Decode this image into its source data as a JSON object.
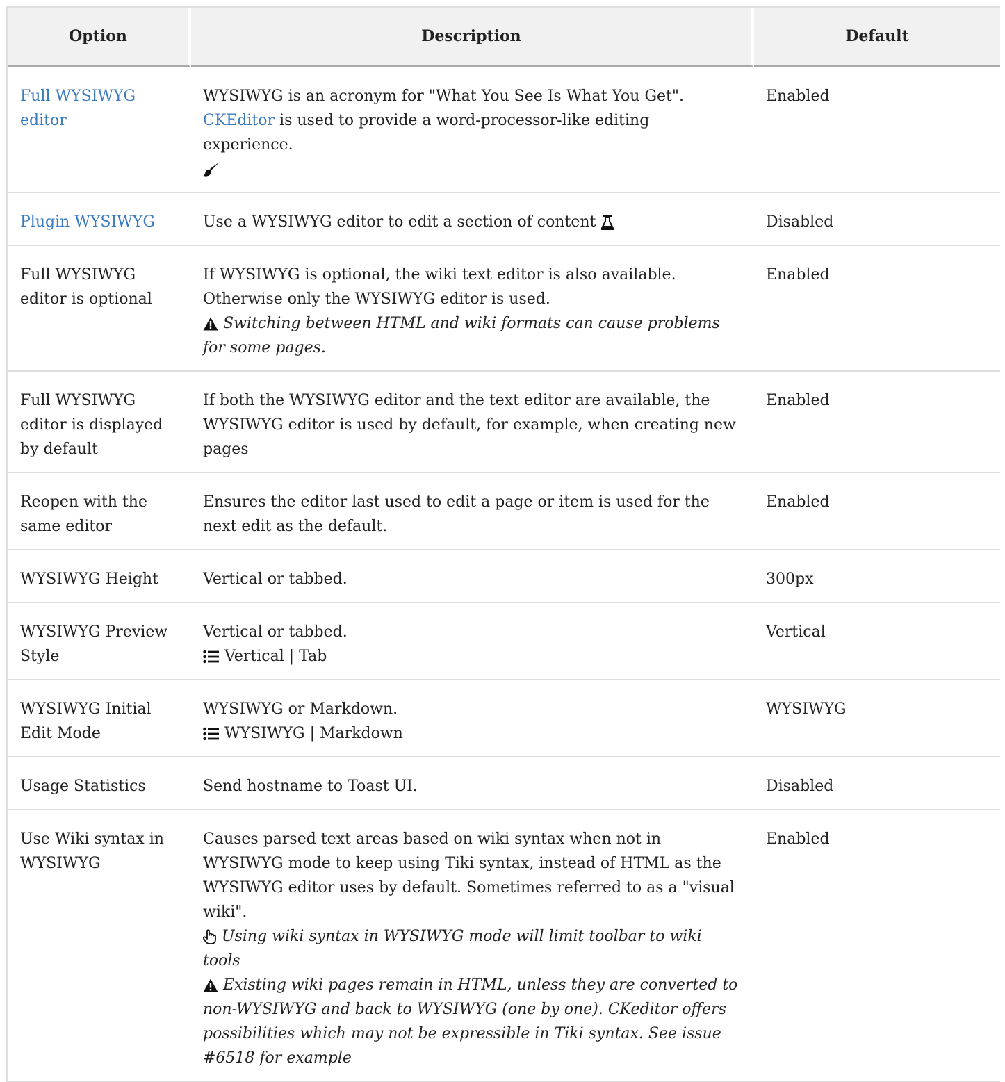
{
  "table": {
    "headers": [
      "Option",
      "Description",
      "Default"
    ],
    "rows": [
      {
        "option": "Full WYSIWYG editor",
        "description": "WYSIWYG is an acronym for \"What You See Is What You Get\".",
        "link": "CKEditor",
        "description_after_link": " is used to provide a word-processor-like editing experience.",
        "icon": "paintbrush-icon",
        "default": "Enabled"
      },
      {
        "option": "Plugin WYSIWYG",
        "description": "Use a WYSIWYG editor to edit a section of content ",
        "icon": "flask-icon",
        "default": "Disabled"
      },
      {
        "option": "Full WYSIWYG editor is optional",
        "description_line1": "If WYSIWYG is optional, the wiki text editor is also available.",
        "description_line2": "Otherwise only the WYSIWYG editor is used.",
        "warning": "Switching between HTML and wiki formats can cause problems for some pages.",
        "default": "Enabled"
      },
      {
        "option": "Full WYSIWYG editor is displayed by default",
        "description": "If both the WYSIWYG editor and the text editor are available, the WYSIWYG editor is used by default, for example, when creating new pages",
        "default": "Enabled"
      },
      {
        "option": "Reopen with the same editor",
        "description": "Ensures the editor last used to edit a page or item is used for the next edit as the default.",
        "default": "Enabled"
      },
      {
        "option": "WYSIWYG Height",
        "description": "Vertical or tabbed.",
        "default": "300px"
      },
      {
        "option": "WYSIWYG Preview Style",
        "description": "Vertical or tabbed.",
        "options_text": "Vertical | Tab",
        "icon": "list-icon",
        "default": "Vertical"
      },
      {
        "option": "WYSIWYG Initial Edit Mode",
        "description": "WYSIWYG or Markdown.",
        "options_text": "WYSIWYG | Markdown",
        "icon": "list-icon",
        "default": "WYSIWYG"
      },
      {
        "option": "Usage Statistics",
        "description": "Send hostname to Toast UI.",
        "default": "Disabled"
      },
      {
        "option": "Use Wiki syntax in WYSIWYG",
        "description": "Causes parsed text areas based on wiki syntax when not in WYSIWYG mode to keep using Tiki syntax, instead of HTML as the WYSIWYG editor uses by default. Sometimes referred to as a \"visual wiki\".",
        "hint": "Using wiki syntax in WYSIWYG mode will limit toolbar to wiki tools",
        "warning": "Existing wiki pages remain in HTML, unless they are converted to non-WYSIWYG and back to WYSIWYG (one by one). CKeditor offers possibilities which may not be expressible in Tiki syntax. See issue #6518 for example",
        "default": "Enabled"
      }
    ]
  },
  "colors": {
    "link": "#3a7bbf",
    "header_bg": "#f1f1f1",
    "border": "#dedede"
  }
}
